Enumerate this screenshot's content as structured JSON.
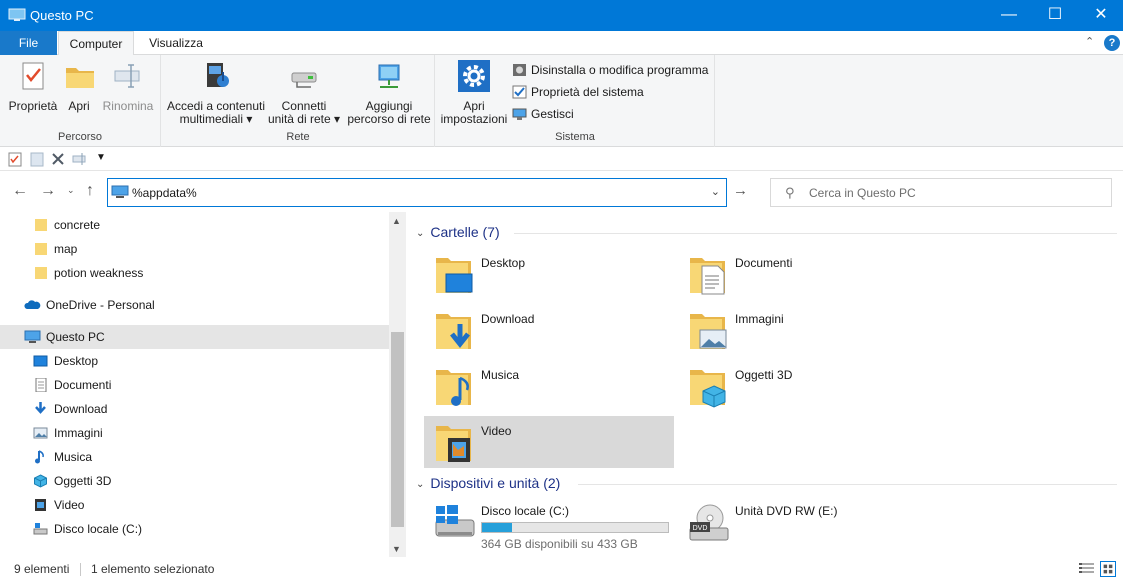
{
  "window": {
    "title": "Questo PC"
  },
  "ribbon_tabs": {
    "file": "File",
    "computer": "Computer",
    "view": "Visualizza"
  },
  "ribbon": {
    "percorso": {
      "label": "Percorso",
      "properties": "Proprietà",
      "open": "Apri",
      "rename": "Rinomina"
    },
    "rete": {
      "label": "Rete",
      "media_line1": "Accedi a contenuti",
      "media_line2": "multimediali ▾",
      "map_line1": "Connetti",
      "map_line2": "unità di rete ▾",
      "add_line1": "Aggiungi",
      "add_line2": "percorso di rete"
    },
    "sistema": {
      "label": "Sistema",
      "settings_line1": "Apri",
      "settings_line2": "impostazioni",
      "uninstall": "Disinstalla o modifica programma",
      "sys_props": "Proprietà del sistema",
      "manage": "Gestisci"
    }
  },
  "address": {
    "value": "%appdata%"
  },
  "search": {
    "placeholder": "Cerca in Questo PC"
  },
  "nav": {
    "items": [
      {
        "label": "concrete",
        "icon": "folder-icon"
      },
      {
        "label": "map",
        "icon": "folder-icon"
      },
      {
        "label": "potion weakness",
        "icon": "folder-icon"
      },
      {
        "label": "OneDrive - Personal",
        "icon": "cloud-icon"
      },
      {
        "label": "Questo PC",
        "icon": "computer-icon"
      },
      {
        "label": "Desktop",
        "icon": "desktop-icon"
      },
      {
        "label": "Documenti",
        "icon": "document-icon"
      },
      {
        "label": "Download",
        "icon": "download-icon"
      },
      {
        "label": "Immagini",
        "icon": "picture-icon"
      },
      {
        "label": "Musica",
        "icon": "music-icon"
      },
      {
        "label": "Oggetti 3D",
        "icon": "cube-icon"
      },
      {
        "label": "Video",
        "icon": "video-icon"
      },
      {
        "label": "Disco locale (C:)",
        "icon": "drive-icon"
      }
    ]
  },
  "content": {
    "folders_header": "Cartelle (7)",
    "folders": [
      {
        "name": "Desktop",
        "icon": "desktop-folder-icon"
      },
      {
        "name": "Documenti",
        "icon": "documents-folder-icon"
      },
      {
        "name": "Download",
        "icon": "download-folder-icon"
      },
      {
        "name": "Immagini",
        "icon": "pictures-folder-icon"
      },
      {
        "name": "Musica",
        "icon": "music-folder-icon"
      },
      {
        "name": "Oggetti 3D",
        "icon": "objects3d-folder-icon"
      },
      {
        "name": "Video",
        "icon": "video-folder-icon"
      }
    ],
    "devices_header": "Dispositivi e unità (2)",
    "devices": [
      {
        "name": "Disco locale (C:)",
        "free_text": "364 GB disponibili su 433 GB",
        "used_fraction": 0.16,
        "icon": "windows-drive-icon"
      },
      {
        "name": "Unità DVD RW (E:)",
        "icon": "dvd-drive-icon"
      }
    ]
  },
  "status": {
    "count": "9 elementi",
    "selection": "1 elemento selezionato"
  },
  "colors": {
    "accent": "#0078d7",
    "selection": "#d9d9d9",
    "folder": "#f8d775",
    "drive_bar": "#26a0da"
  }
}
